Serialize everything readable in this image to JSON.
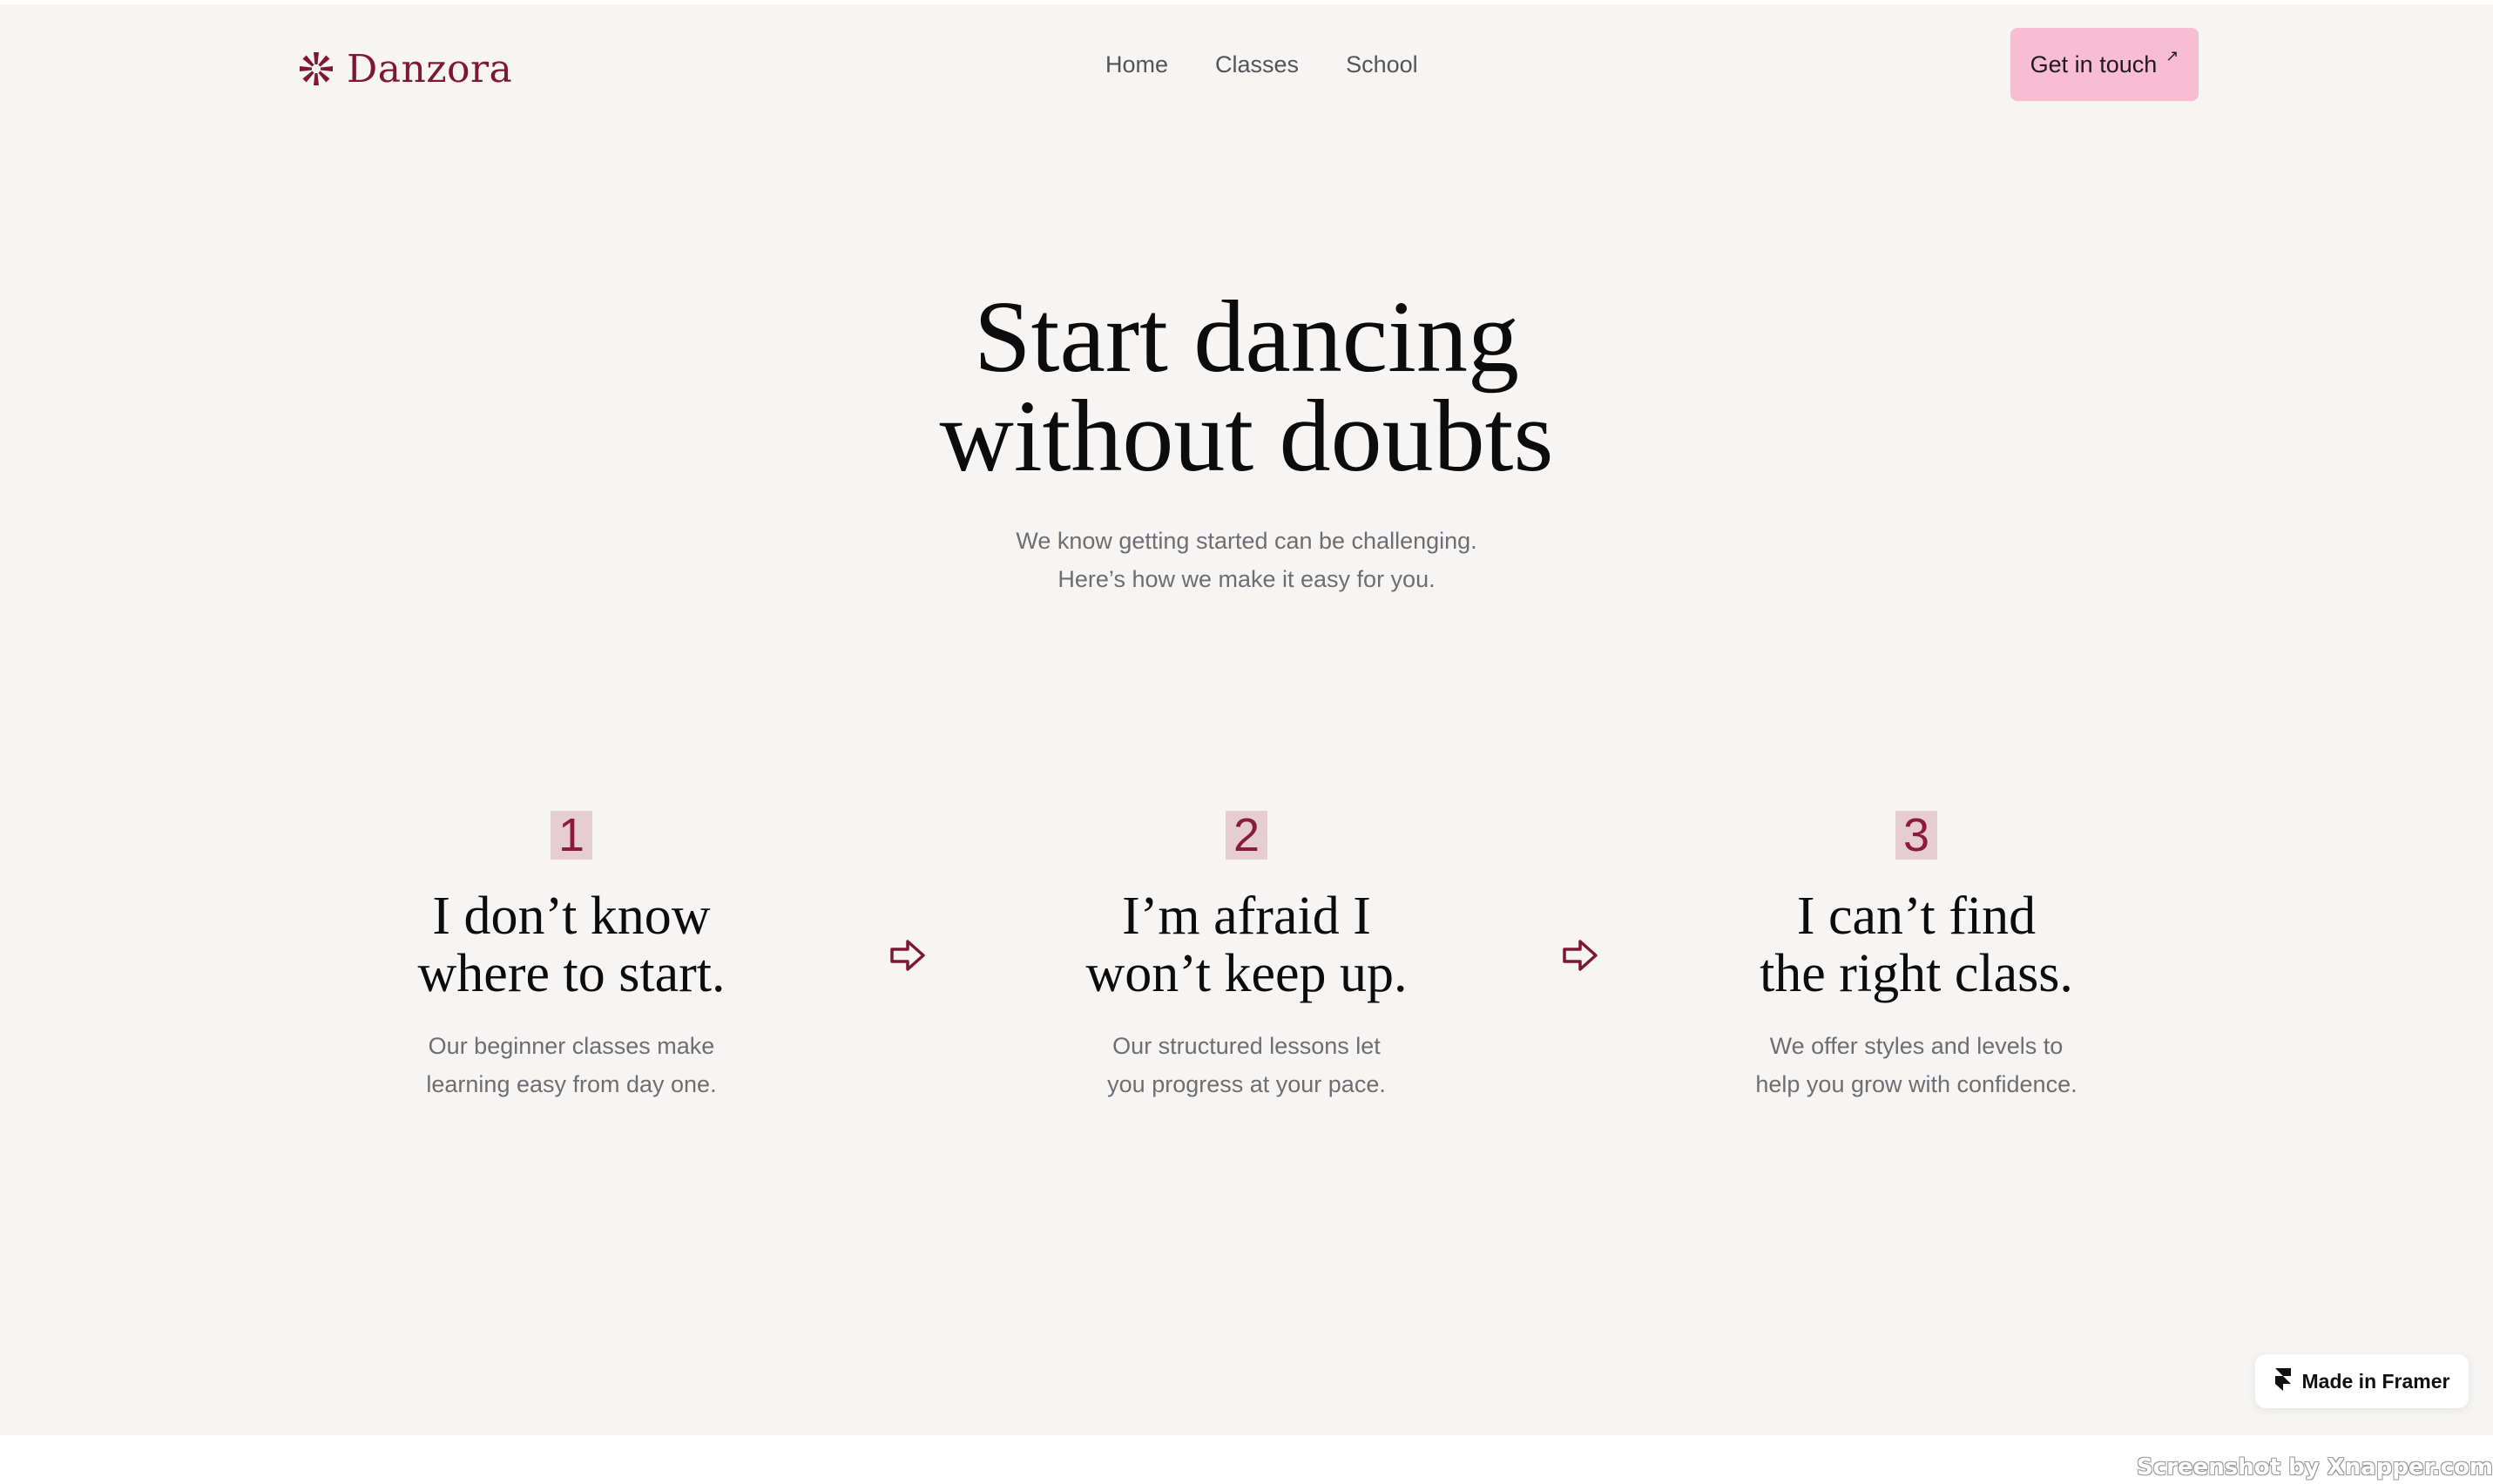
{
  "colors": {
    "background": "#f6f5f3",
    "brand": "#7f1733",
    "accent_button": "#f9bdd3",
    "number_highlight": "#e6cdd4",
    "heading": "#0c0b0d",
    "muted_text": "#6f6d74"
  },
  "header": {
    "logo": {
      "icon": "asterisk-flower-icon",
      "text": "Danzora"
    },
    "nav": [
      {
        "label": "Home"
      },
      {
        "label": "Classes"
      },
      {
        "label": "School"
      }
    ],
    "cta": {
      "label": "Get in touch",
      "icon": "arrow-up-right-icon",
      "glyph": "↗"
    }
  },
  "hero": {
    "title_lines": [
      "Start dancing",
      "without doubts"
    ],
    "subtitle_lines": [
      "We know getting started can be challenging.",
      "Here’s how we make it easy for you."
    ]
  },
  "steps": [
    {
      "number": "1",
      "title_lines": [
        "I don’t know",
        "where to start."
      ],
      "desc_lines": [
        "Our beginner classes make",
        "learning easy from day one."
      ]
    },
    {
      "number": "2",
      "title_lines": [
        "I’m afraid I",
        "won’t keep up."
      ],
      "desc_lines": [
        "Our structured lessons let",
        "you progress at your pace."
      ]
    },
    {
      "number": "3",
      "title_lines": [
        "I can’t find",
        "the right class."
      ],
      "desc_lines": [
        "We offer styles and levels to",
        "help you grow with confidence."
      ]
    }
  ],
  "step_arrows": [
    "arrow-right-outline-icon",
    "arrow-right-outline-icon"
  ],
  "badge": {
    "icon": "framer-logo-icon",
    "label": "Made in Framer"
  },
  "watermark": "Screenshot by Xnapper.com"
}
